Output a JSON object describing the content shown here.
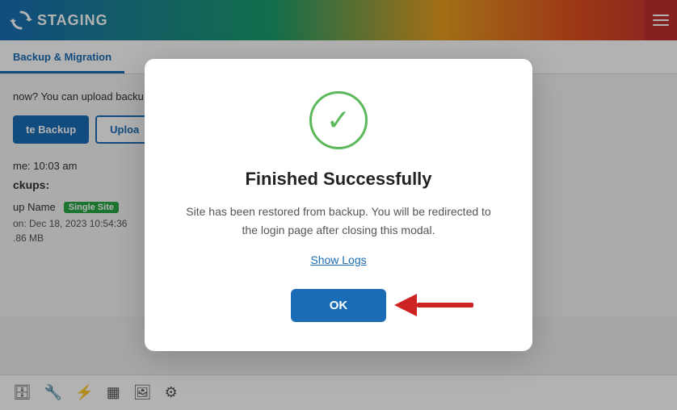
{
  "header": {
    "logo_text": "STAGING",
    "logo_icon": "↻"
  },
  "nav": {
    "active_tab": "Backup & Migration"
  },
  "main": {
    "info_text": "now? You can upload backu",
    "btn_create": "te Backup",
    "btn_upload": "Uploa",
    "time_label": "me: 10:03 am",
    "backups_label": "ckups:",
    "backup_name_label": "up Name",
    "badge_text": "Single Site",
    "backup_meta1": "on: Dec 18, 2023 10:54:36",
    "backup_meta2": ".86 MB"
  },
  "modal": {
    "success_icon": "✓",
    "title": "Finished Successfully",
    "body_text": "Site has been restored from backup. You will be redirected to the login page after closing this modal.",
    "show_logs": "Show Logs",
    "ok_button": "OK"
  },
  "toolbar": {
    "icons": [
      "🗄",
      "🔧",
      "⚡",
      "▦",
      "🖼",
      "⚙"
    ]
  },
  "colors": {
    "blue": "#1a6db5",
    "green": "#5cb85c",
    "badge_green": "#28a745",
    "red_arrow": "#cc2222"
  }
}
